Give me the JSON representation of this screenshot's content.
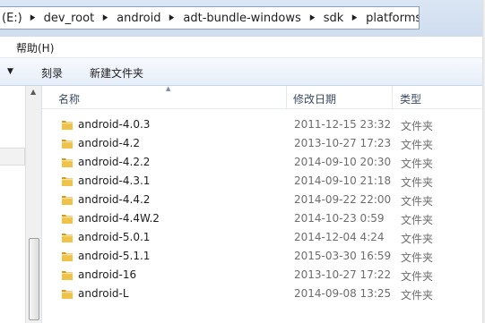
{
  "address_bar": {
    "crumbs": [
      "(E:)",
      "dev_root",
      "android",
      "adt-bundle-windows",
      "sdk",
      "platforms"
    ]
  },
  "menu": {
    "help_label": "帮助(H)"
  },
  "toolbar": {
    "burn_label": "刻录",
    "new_folder_label": "新建文件夹"
  },
  "columns": {
    "name": "名称",
    "modified": "修改日期",
    "type": "类型"
  },
  "files": [
    {
      "name": "android-4.0.3",
      "modified": "2011-12-15 23:32",
      "type": "文件夹"
    },
    {
      "name": "android-4.2",
      "modified": "2013-10-27 17:23",
      "type": "文件夹"
    },
    {
      "name": "android-4.2.2",
      "modified": "2014-09-10 20:30",
      "type": "文件夹"
    },
    {
      "name": "android-4.3.1",
      "modified": "2014-09-10 21:18",
      "type": "文件夹"
    },
    {
      "name": "android-4.4.2",
      "modified": "2014-09-22 22:00",
      "type": "文件夹"
    },
    {
      "name": "android-4.4W.2",
      "modified": "2014-10-23 0:59",
      "type": "文件夹"
    },
    {
      "name": "android-5.0.1",
      "modified": "2014-12-04 4:24",
      "type": "文件夹"
    },
    {
      "name": "android-5.1.1",
      "modified": "2015-03-30 16:59",
      "type": "文件夹"
    },
    {
      "name": "android-16",
      "modified": "2013-10-27 17:22",
      "type": "文件夹"
    },
    {
      "name": "android-L",
      "modified": "2014-09-08 13:25",
      "type": "文件夹"
    }
  ],
  "colors": {
    "folder_fill": "#f0c24a",
    "folder_dark": "#d49a1e",
    "header_text": "#3a4a64",
    "secondary_text": "#6d6d6d"
  }
}
